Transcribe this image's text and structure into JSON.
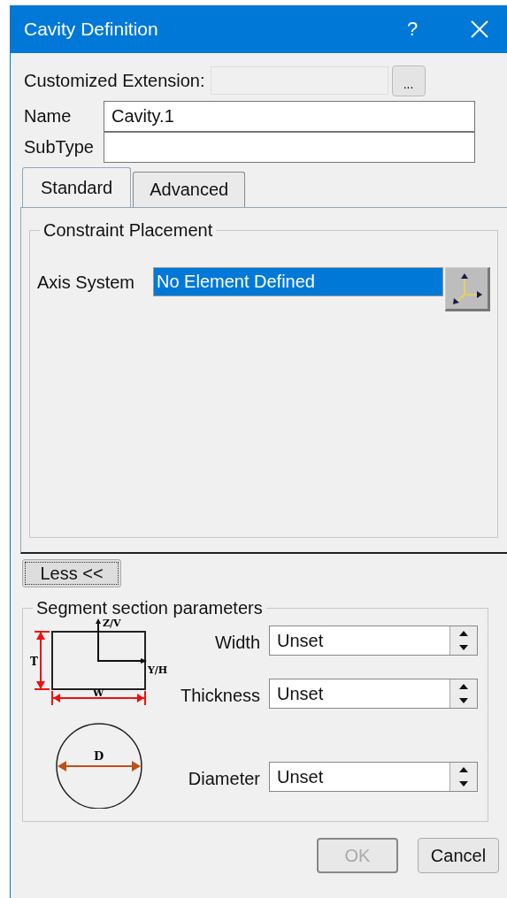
{
  "window": {
    "title": "Cavity Definition",
    "help": "?"
  },
  "customized_extension": {
    "label": "Customized Extension:",
    "browse_button": "..."
  },
  "name": {
    "label": "Name",
    "value": "Cavity.1"
  },
  "subtype": {
    "label": "SubType"
  },
  "tabs": [
    {
      "label": "Standard",
      "selected": true
    },
    {
      "label": "Advanced",
      "selected": false
    }
  ],
  "constraint_placement": {
    "title": "Constraint Placement",
    "axis_system": {
      "label": "Axis System",
      "value": "No Element Defined",
      "selected": true
    }
  },
  "less_button": "Less <<",
  "segment_section": {
    "title": "Segment section parameters",
    "rectangle_labels": {
      "z_axis": "Z/V",
      "y_axis": "Y/H",
      "height": "T",
      "width": "W"
    },
    "circle_label": "D",
    "parameters": [
      {
        "label": "Width",
        "value": "Unset"
      },
      {
        "label": "Thickness",
        "value": "Unset"
      },
      {
        "label": "Diameter",
        "value": "Unset"
      }
    ]
  },
  "buttons": [
    {
      "label": "OK",
      "disabled": true
    },
    {
      "label": "Cancel",
      "disabled": false
    }
  ]
}
